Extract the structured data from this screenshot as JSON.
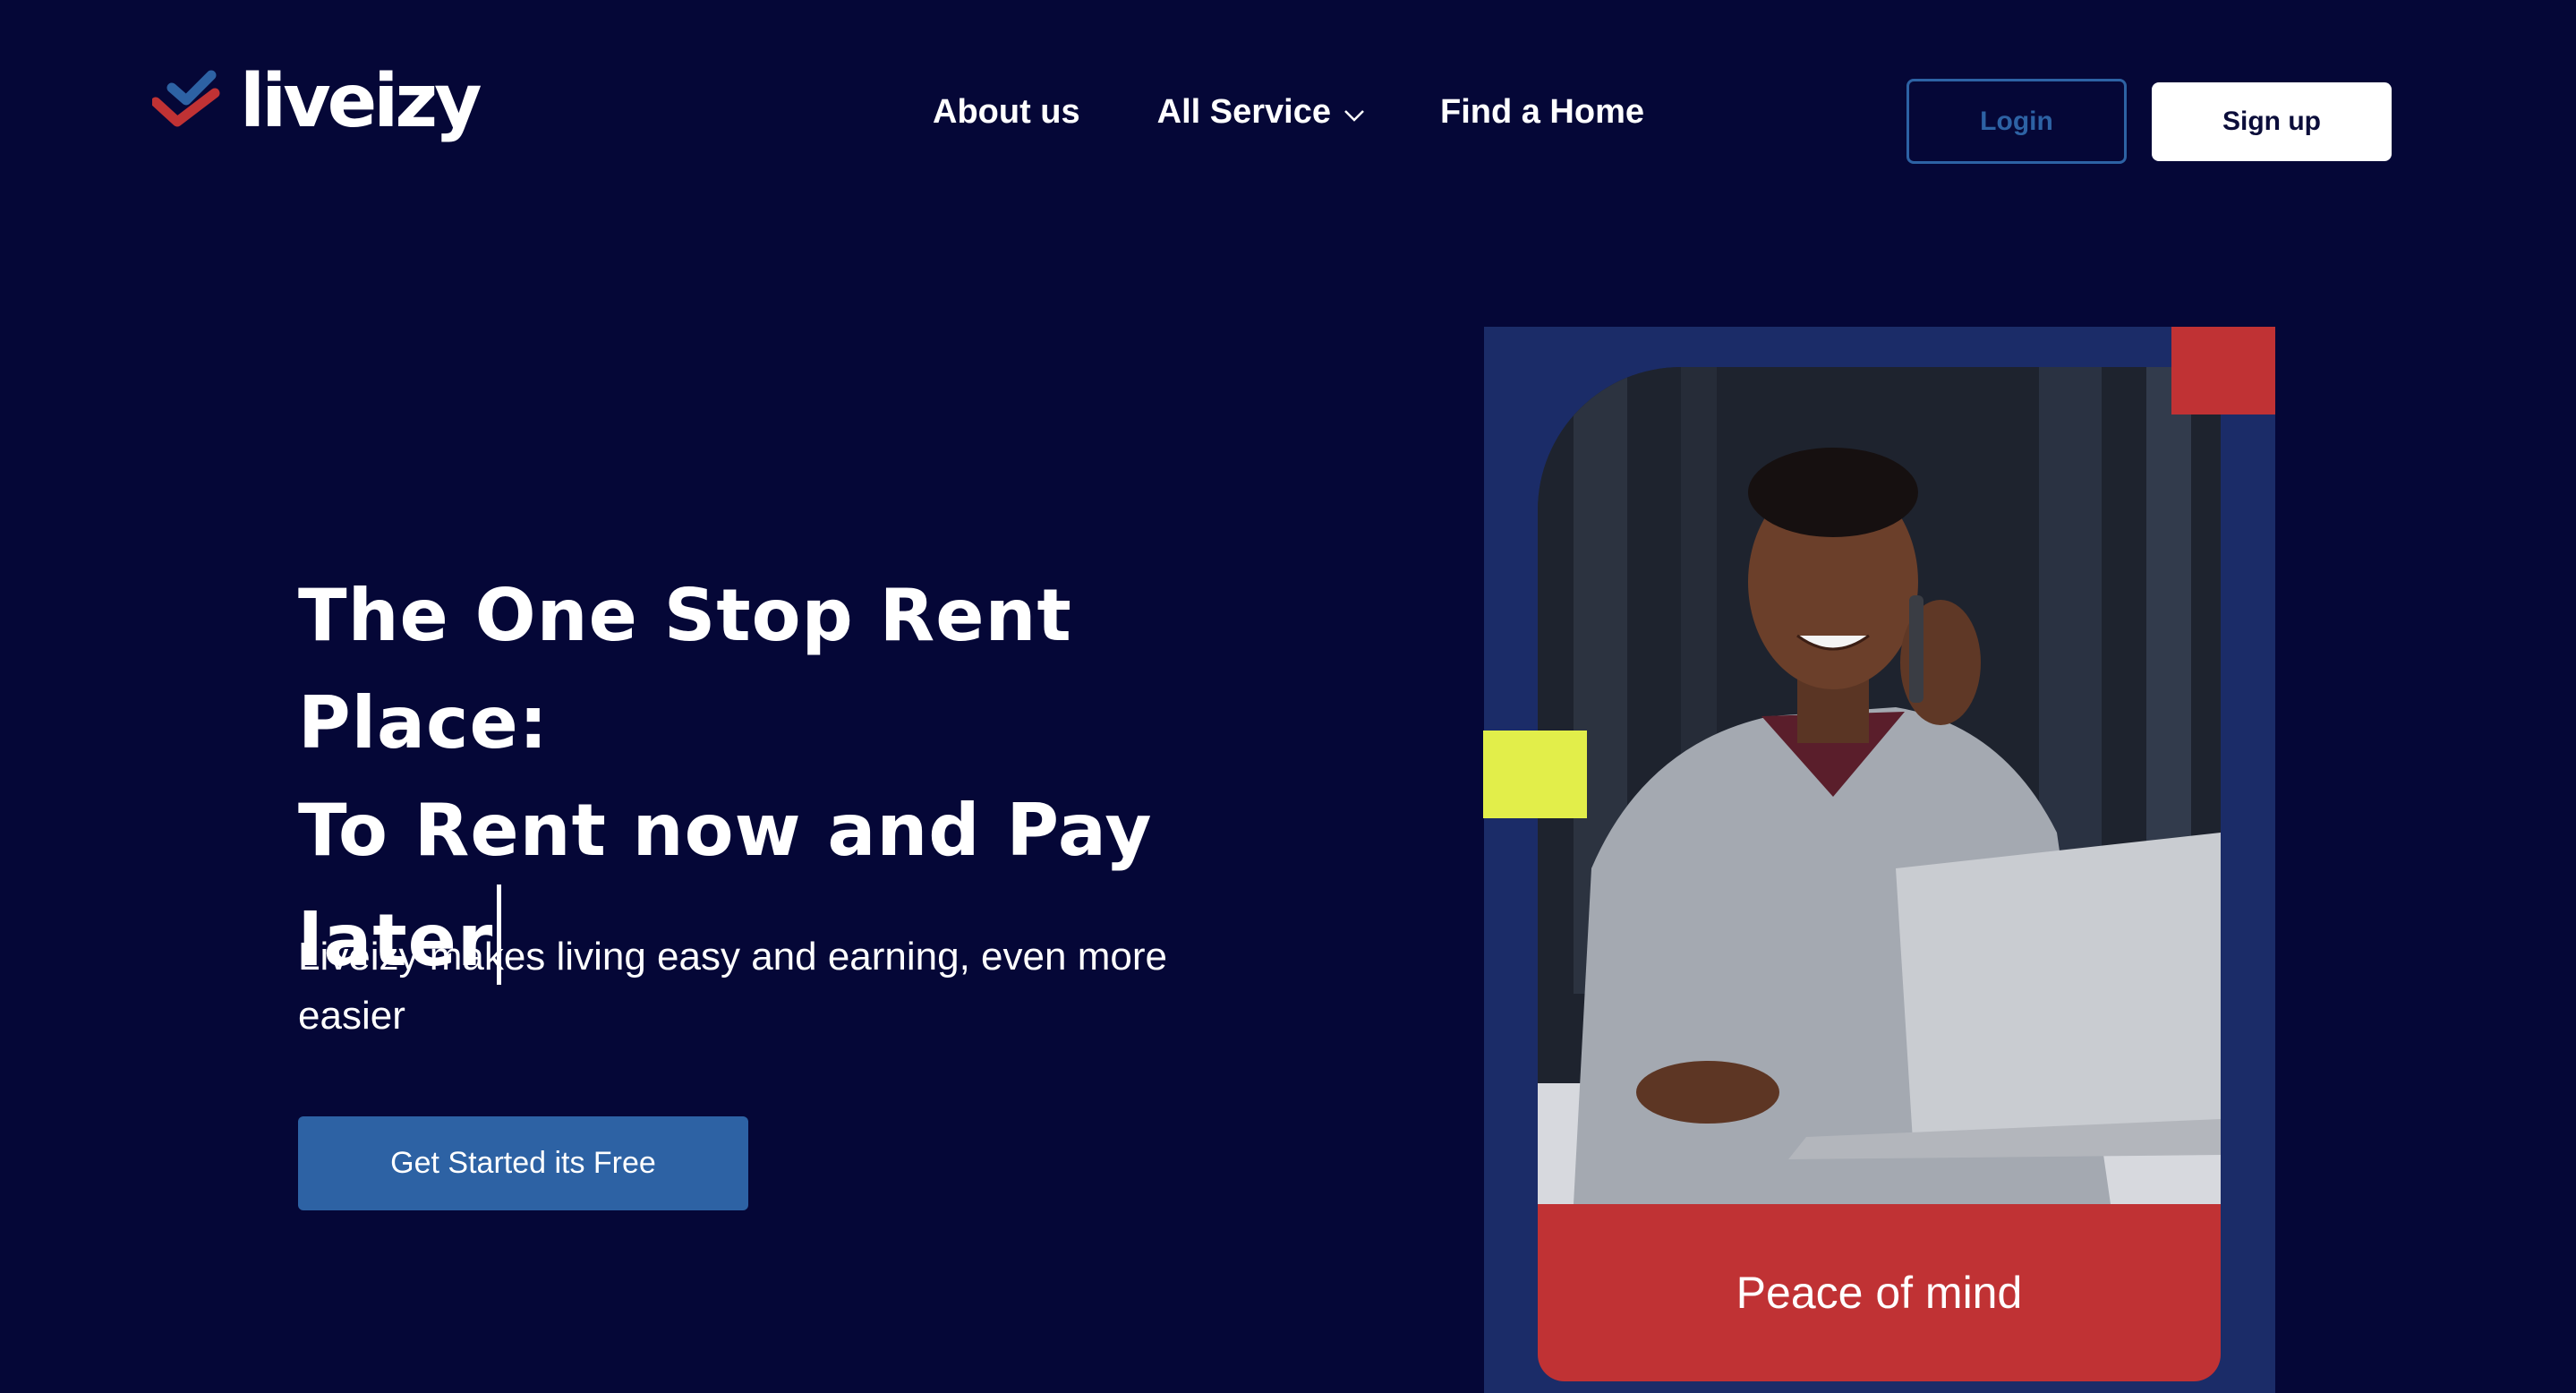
{
  "brand": {
    "name": "liveizy",
    "logo_icon": "check-mark-logo-icon"
  },
  "nav": {
    "about": "About us",
    "services": "All Service",
    "find_home": "Find a Home"
  },
  "auth": {
    "login": "Login",
    "signup": "Sign up"
  },
  "hero": {
    "title_line1": "The One Stop Rent Place:",
    "title_line2": "To Rent now and Pay",
    "title_line3": "later",
    "subtitle": "Liveizy makes living easy and earning, even more easier",
    "cta": "Get Started its Free"
  },
  "card": {
    "caption": "Peace of mind"
  },
  "colors": {
    "background": "#050737",
    "accent_blue": "#2d62a4",
    "frame_blue": "#1b2c68",
    "accent_red": "#c03234",
    "accent_yellow": "#e2ee4a"
  }
}
